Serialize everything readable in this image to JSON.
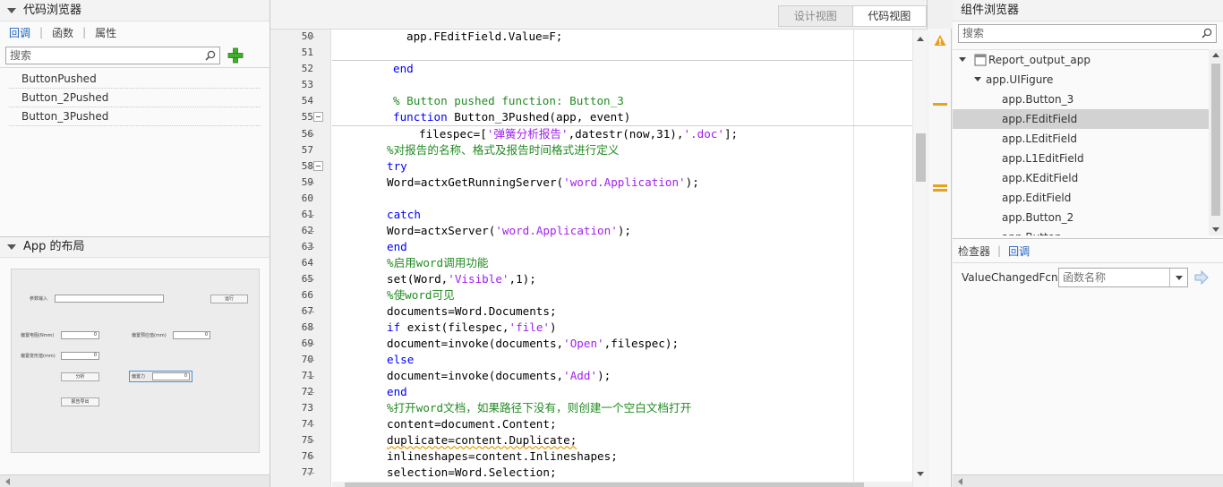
{
  "left_panel": {
    "title": "代码浏览器",
    "tabs": [
      {
        "label": "回调",
        "active": true
      },
      {
        "label": "函数",
        "active": false
      },
      {
        "label": "属性",
        "active": false
      }
    ],
    "search_placeholder": "搜索",
    "callbacks": [
      "ButtonPushed",
      "Button_2Pushed",
      "Button_3Pushed"
    ],
    "layout_title": "App 的布局",
    "layout_preview": {
      "param_label": "参数输入",
      "run_button": "运行",
      "field1_label": "偏置电阻(Nmm)",
      "field1_value": "0",
      "field2_label": "偏置预应值(mm)",
      "field2_value": "0",
      "field3_label": "偏置变形值(mm)",
      "field3_value": "0",
      "analyze_button": "分析",
      "force_label": "偏置力",
      "force_value": "0",
      "report_button": "报告导出"
    }
  },
  "view_toggle": {
    "design_view": "设计视图",
    "code_view": "代码视图",
    "active": "code_view"
  },
  "editor": {
    "lines": [
      {
        "n": "50",
        "dash": true,
        "text": "app.FEditField.Value=F;"
      },
      {
        "n": "51",
        "dash": false,
        "text": ""
      },
      {
        "n": "52",
        "dash": false,
        "text": "end"
      },
      {
        "n": "53",
        "dash": false,
        "text": ""
      },
      {
        "n": "54",
        "dash": false,
        "text": "% Button pushed function: Button_3"
      },
      {
        "n": "55",
        "dash": false,
        "text": "function Button_3Pushed(app, event)"
      },
      {
        "n": "56",
        "dash": true,
        "text_parts": [
          "filespec=[",
          "'弹簧分析报告'",
          ",datestr(now,31),",
          "'.doc'",
          "];"
        ]
      },
      {
        "n": "57",
        "dash": false,
        "text": "%对报告的名称、格式及报告时间格式进行定义"
      },
      {
        "n": "58",
        "dash": true,
        "text": "try"
      },
      {
        "n": "59",
        "dash": true,
        "text_parts": [
          "Word=actxGetRunningServer(",
          "'word.Application'",
          ");"
        ]
      },
      {
        "n": "60",
        "dash": false,
        "text": ""
      },
      {
        "n": "61",
        "dash": true,
        "text": "catch"
      },
      {
        "n": "62",
        "dash": true,
        "text_parts": [
          "Word=actxServer(",
          "'word.Application'",
          ");"
        ]
      },
      {
        "n": "63",
        "dash": true,
        "text": "end"
      },
      {
        "n": "64",
        "dash": false,
        "text": "%启用word调用功能"
      },
      {
        "n": "65",
        "dash": true,
        "text_parts": [
          "set(Word,",
          "'Visible'",
          ",1);"
        ]
      },
      {
        "n": "66",
        "dash": false,
        "text": "%使word可见"
      },
      {
        "n": "67",
        "dash": true,
        "text": "documents=Word.Documents;"
      },
      {
        "n": "68",
        "dash": true,
        "text_parts": [
          "if",
          " exist(filespec,",
          "'file'",
          ")"
        ]
      },
      {
        "n": "69",
        "dash": true,
        "text_parts": [
          "document=invoke(documents,",
          "'Open'",
          ",filespec);"
        ]
      },
      {
        "n": "70",
        "dash": true,
        "text": "else"
      },
      {
        "n": "71",
        "dash": true,
        "text_parts": [
          "document=invoke(documents,",
          "'Add'",
          ");"
        ]
      },
      {
        "n": "72",
        "dash": true,
        "text": "end"
      },
      {
        "n": "73",
        "dash": false,
        "text": "%打开word文档，如果路径下没有，则创建一个空白文档打开"
      },
      {
        "n": "74",
        "dash": true,
        "text": "content=document.Content;"
      },
      {
        "n": "75",
        "dash": true,
        "text": "duplicate=content.Duplicate;"
      },
      {
        "n": "76",
        "dash": true,
        "text": "inlineshapes=content.Inlineshapes;"
      },
      {
        "n": "77",
        "dash": true,
        "text": "selection=Word.Selection;"
      }
    ]
  },
  "right_panel": {
    "title": "组件浏览器",
    "search_placeholder": "搜索",
    "tree": [
      {
        "label": "Report_output_app",
        "level": 0,
        "selected": false
      },
      {
        "label": "app.UIFigure",
        "level": 1,
        "selected": false
      },
      {
        "label": "app.Button_3",
        "level": 2,
        "selected": false
      },
      {
        "label": "app.FEditField",
        "level": 2,
        "selected": true
      },
      {
        "label": "app.LEditField",
        "level": 2,
        "selected": false
      },
      {
        "label": "app.L1EditField",
        "level": 2,
        "selected": false
      },
      {
        "label": "app.KEditField",
        "level": 2,
        "selected": false
      },
      {
        "label": "app.EditField",
        "level": 2,
        "selected": false
      },
      {
        "label": "app.Button_2",
        "level": 2,
        "selected": false
      },
      {
        "label": "app.Button",
        "level": 2,
        "selected": false
      }
    ],
    "inspector_tabs": [
      {
        "label": "检查器",
        "active": false
      },
      {
        "label": "回调",
        "active": true
      }
    ],
    "property": {
      "name": "ValueChangedFcn",
      "placeholder": "函数名称"
    }
  },
  "colors": {
    "keyword": "#0000ff",
    "string": "#a020f0",
    "comment": "#228b22",
    "warning": "#e8a11c",
    "active_tab": "#1d5fbf",
    "selected_row": "#d2d2d2"
  }
}
